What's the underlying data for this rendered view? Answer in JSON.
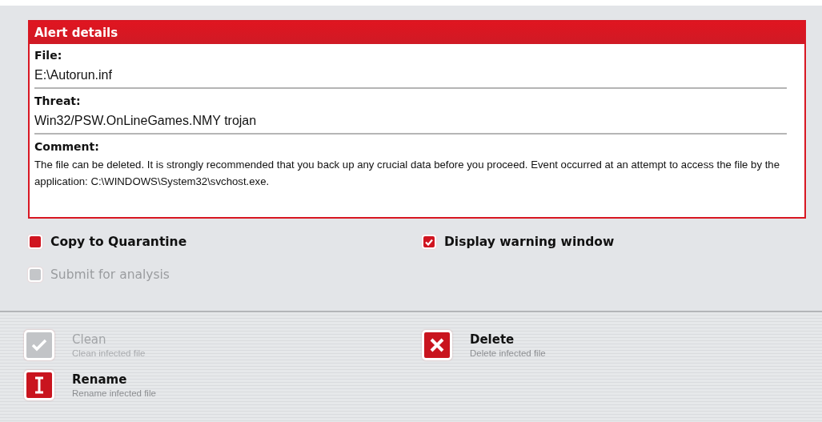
{
  "alert": {
    "title": "Alert details",
    "fields": [
      {
        "label": "File:",
        "value": "E:\\Autorun.inf"
      },
      {
        "label": "Threat:",
        "value": "Win32/PSW.OnLineGames.NMY trojan"
      },
      {
        "label": "Comment:",
        "value": "The file can be deleted. It is strongly recommended that you back up any crucial data before you proceed. Event occurred at an attempt to access the file by the application: C:\\WINDOWS\\System32\\svchost.exe."
      }
    ]
  },
  "options": [
    [
      {
        "label": "Copy to Quarantine",
        "checked": false,
        "disabled": false
      },
      {
        "label": "Submit for analysis",
        "checked": false,
        "disabled": true
      }
    ],
    [
      {
        "label": "Display warning window",
        "checked": true,
        "disabled": false
      }
    ]
  ],
  "actions": [
    [
      {
        "kind": "clean",
        "title": "Clean",
        "subtitle": "Clean infected file",
        "disabled": true
      },
      {
        "kind": "rename",
        "title": "Rename",
        "subtitle": "Rename infected file",
        "disabled": false
      }
    ],
    [
      {
        "kind": "delete",
        "title": "Delete",
        "subtitle": "Delete infected file",
        "disabled": false
      }
    ]
  ]
}
